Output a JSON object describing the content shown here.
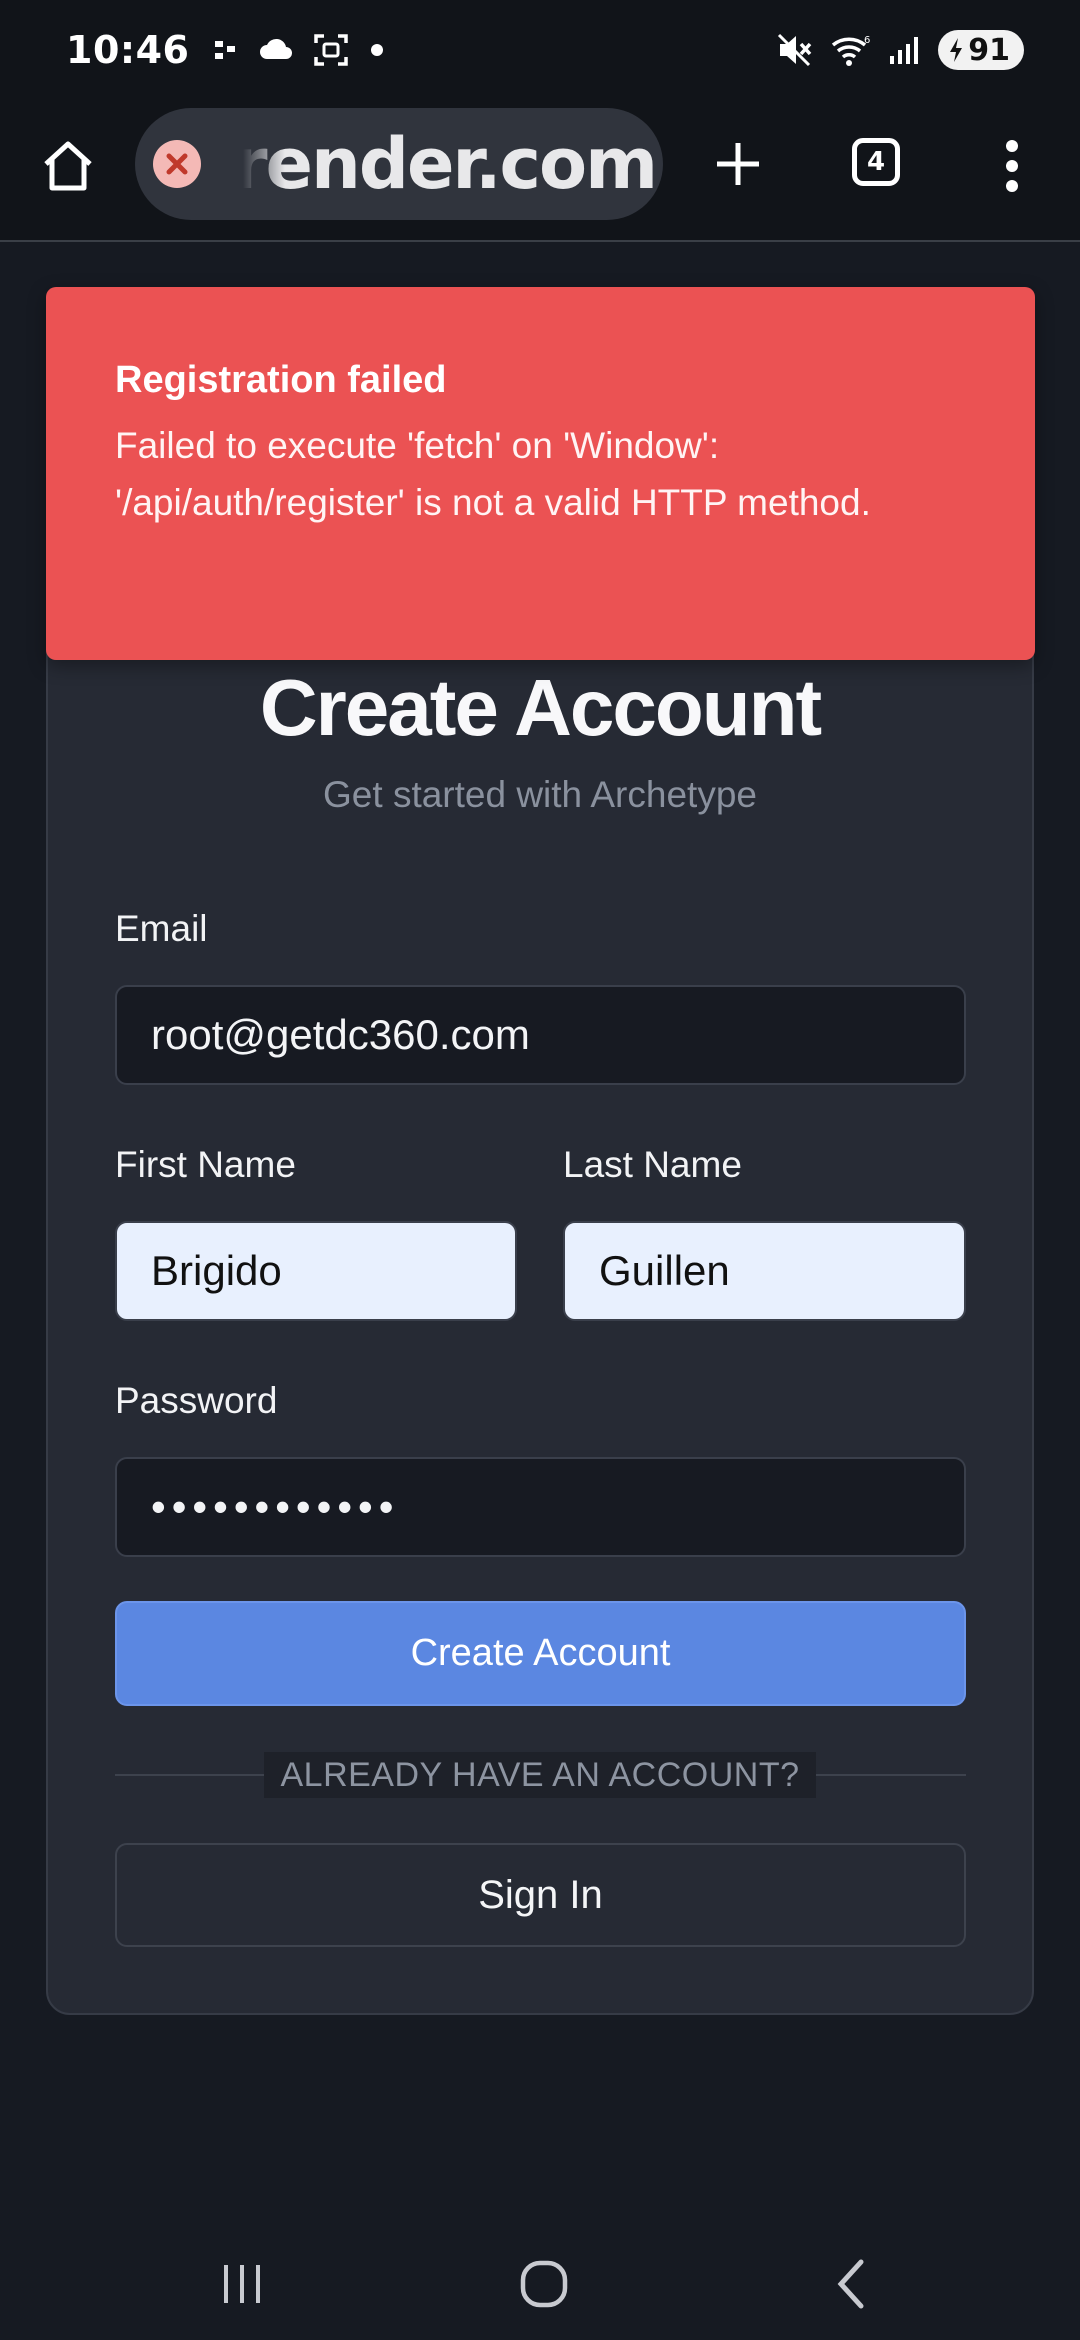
{
  "status_bar": {
    "time": "10:46",
    "battery_level": "91",
    "left_icons": [
      "signal-dots-icon",
      "cloud-icon",
      "screenshot-icon",
      "notification-dot-icon"
    ],
    "right_icons": [
      "mute-icon",
      "wifi-icon",
      "cell-signal-icon",
      "battery-charging-icon"
    ]
  },
  "browser": {
    "url_display": "render.com",
    "tab_count": "4",
    "icons": [
      "home-icon",
      "site-error-icon",
      "new-tab-icon",
      "tab-switcher-icon",
      "more-menu-icon"
    ]
  },
  "toast": {
    "title": "Registration failed",
    "message": "Failed to execute 'fetch' on 'Window': '/api/auth/register' is not a valid HTTP method.",
    "background": "#eb5253"
  },
  "form": {
    "title": "Create Account",
    "subtitle": "Get started with Archetype",
    "email": {
      "label": "Email",
      "value": "root@getdc360.com"
    },
    "first_name": {
      "label": "First Name",
      "value": "Brigido"
    },
    "last_name": {
      "label": "Last Name",
      "value": "Guillen"
    },
    "password": {
      "label": "Password",
      "value": "••••••••••••"
    },
    "submit_label": "Create Account",
    "divider_text": "ALREADY HAVE AN ACCOUNT?",
    "signin_label": "Sign In"
  },
  "theme": {
    "accent": "#5b87e1",
    "card": "#262a34",
    "page": "#161a22"
  },
  "nav_bar": {
    "icons": [
      "recent-apps-icon",
      "home-nav-icon",
      "back-icon"
    ]
  }
}
